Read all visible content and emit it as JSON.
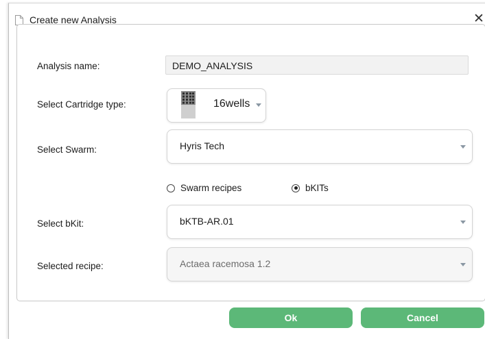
{
  "window": {
    "title": "Create new Analysis",
    "close_glyph": "✕"
  },
  "form": {
    "analysis_name_label": "Analysis name:",
    "analysis_name_value": "DEMO_ANALYSIS",
    "cartridge_label": "Select Cartridge type:",
    "cartridge_value": "16wells",
    "swarm_label": "Select Swarm:",
    "swarm_value": "Hyris Tech",
    "radio_swarm_recipes": "Swarm recipes",
    "radio_bkits": "bKITs",
    "radio_selected": "bKITs",
    "bkit_label": "Select bKit:",
    "bkit_value": "bKTB-AR.01",
    "recipe_label": "Selected recipe:",
    "recipe_value": "Actaea racemosa 1.2"
  },
  "buttons": {
    "ok": "Ok",
    "cancel": "Cancel"
  },
  "colors": {
    "button_green": "#5cb878",
    "radio_dot": "#222222",
    "caret": "#8a97a3"
  },
  "icons": [
    "document-icon",
    "close-icon",
    "cartridge-16wells-icon",
    "chevron-down-icon"
  ]
}
